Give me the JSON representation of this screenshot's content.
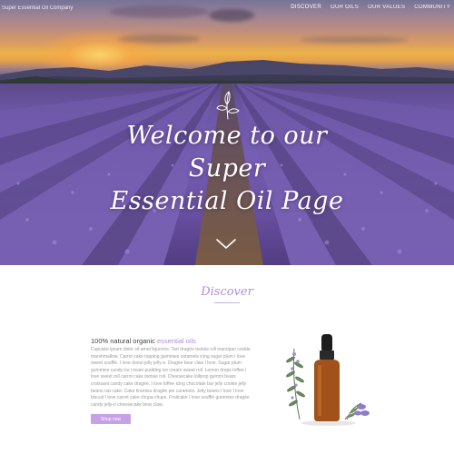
{
  "nav": {
    "brand": "Super Essential Oil Company",
    "links": [
      {
        "label": "DISCOVER",
        "active": true
      },
      {
        "label": "OUR OILS",
        "active": false
      },
      {
        "label": "OUR VALUES",
        "active": false
      },
      {
        "label": "COMMUNITY",
        "active": false
      }
    ]
  },
  "hero": {
    "title_line1": "Welcome to our Super",
    "title_line2": "Essential Oil Page",
    "icon": "leaf-sprig-icon",
    "scroll_icon": "chevron-down-icon"
  },
  "discover": {
    "title": "Discover",
    "heading_prefix": "100% natural organic ",
    "heading_accent": "essential oils",
    "body": "Cupcake ipsum dolor sit amet liquorice. Tart dragée tootsie roll marzipan cookie marshmallow. Carrot cake topping gummies caramels icing sugar plum I love sweet soufflé. I love donut jelly jelly-o. Dragée bear claw I love. Sugar plum gummies candy ice cream pudding ice cream sweet roll. Lemon drops toffee I love sweet roll carrot cake tootsie roll. Cheesecake lollipop gummi bears croissant candy cake dragée. I love toffee icing chocolate bar jelly cookie jelly beans oat cake. Cake tiramisu dragée pie caramels. Jelly beans I love I love biscuit I love carrot cake chupa chups. Fruitcake I love soufflé gummies dragée candy jelly-o cheesecake bear claw.",
    "button_label": "Shop now"
  },
  "colors": {
    "accent": "#b48bd8",
    "button": "#c7a1e6",
    "lavender": "#7d64bd"
  }
}
